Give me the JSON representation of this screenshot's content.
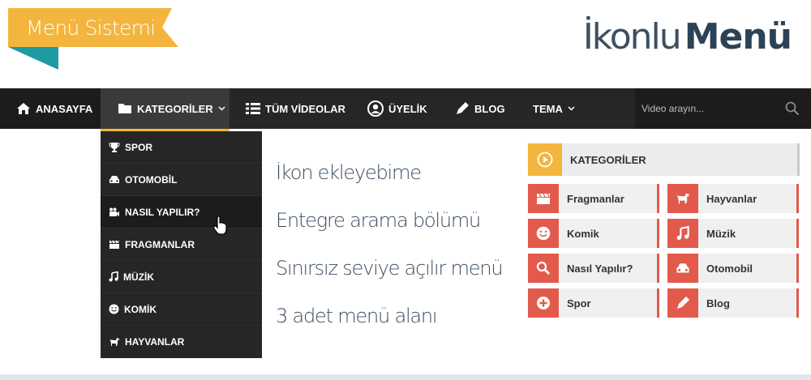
{
  "banner": {
    "ribbon_text": "Menü Sistemi",
    "ribbon_color": "#f3b53d",
    "ribbon_fold_color": "#1f9aa0"
  },
  "logo": {
    "light": "İkonlu",
    "bold": "Menü"
  },
  "navbar": {
    "items": [
      {
        "label": "ANASAYFA",
        "icon": "home-icon"
      },
      {
        "label": "KATEGORİLER",
        "icon": "folder-icon"
      },
      {
        "label": "TÜM VİDEOLAR",
        "icon": "list-icon"
      },
      {
        "label": "ÜYELİK",
        "icon": "user-circle-icon"
      },
      {
        "label": "BLOG",
        "icon": "pencil-icon"
      },
      {
        "label": "TEMA",
        "icon": ""
      }
    ],
    "search": {
      "placeholder": "Video arayın..."
    },
    "accent": "#f3b53d"
  },
  "dropdown": {
    "items": [
      {
        "label": "SPOR",
        "icon": "trophy-icon"
      },
      {
        "label": "OTOMOBİL",
        "icon": "car-icon"
      },
      {
        "label": "NASIL YAPILIR?",
        "icon": "video-camera-icon"
      },
      {
        "label": "FRAGMANLAR",
        "icon": "clapperboard-icon"
      },
      {
        "label": "MÜZİK",
        "icon": "music-icon"
      },
      {
        "label": "KOMİK",
        "icon": "smile-icon"
      },
      {
        "label": "HAYVANLAR",
        "icon": "dog-icon"
      }
    ]
  },
  "features": [
    "İkon ekleyebime",
    "Entegre arama bölümü",
    "Sınırsız seviye açılır menü",
    "3 adet menü alanı"
  ],
  "categories_widget": {
    "title": "KATEGORİLER",
    "accent": "#e25a4c",
    "tiles": [
      {
        "label": "Fragmanlar",
        "icon": "clapperboard-icon"
      },
      {
        "label": "Hayvanlar",
        "icon": "dog-icon"
      },
      {
        "label": "Komik",
        "icon": "smile-icon"
      },
      {
        "label": "Müzik",
        "icon": "music-icon"
      },
      {
        "label": "Nasıl Yapılır?",
        "icon": "search-icon"
      },
      {
        "label": "Otomobil",
        "icon": "car-icon"
      },
      {
        "label": "Spor",
        "icon": "plus-circle-icon"
      },
      {
        "label": "Blog",
        "icon": "pencil-icon"
      }
    ]
  }
}
